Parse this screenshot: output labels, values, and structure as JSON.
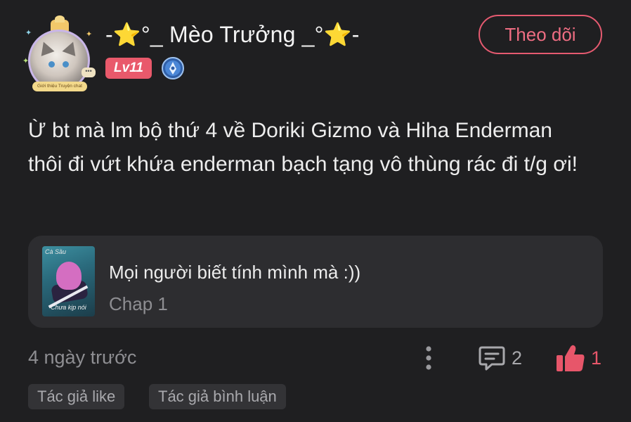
{
  "user": {
    "name": "-⭐°_ Mèo Trưởng _°⭐-",
    "level": "Lv11",
    "avatar_banner": "Giới thiệu Truyện chat"
  },
  "follow_button": {
    "label": "Theo dõi"
  },
  "comment": {
    "text": "Ừ bt mà lm bộ thứ 4 về Doriki Gizmo và Hiha Enderman thôi đi vứt khứa enderman bạch tạng vô thùng rác đi t/g ơi!"
  },
  "chapter_card": {
    "title": "Mọi người biết tính mình mà :))",
    "subtitle": "Chap 1",
    "thumbnail_title": "Cà Sầu",
    "thumbnail_subtitle": "Chưa kịp nói"
  },
  "footer": {
    "timestamp": "4 ngày trước",
    "reply_count": "2",
    "like_count": "1"
  },
  "tags": [
    "Tác giả like",
    "Tác giả bình luận"
  ],
  "icons": {
    "more": "more-vertical-icon",
    "comment": "comment-icon",
    "like": "thumbs-up-icon",
    "verify": "verified-badge-icon"
  },
  "colors": {
    "background": "#1f1f21",
    "accent": "#e55a70",
    "level_badge": "#e9596b",
    "like": "#e7566a",
    "card": "#2d2d30"
  }
}
